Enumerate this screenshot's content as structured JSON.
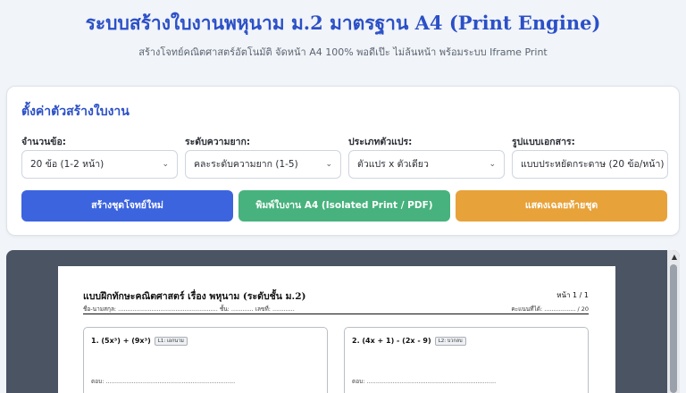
{
  "header": {
    "title": "ระบบสร้างใบงานพหุนาม ม.2 มาตรฐาน A4 (Print Engine)",
    "subtitle": "สร้างโจทย์คณิตศาสตร์อัตโนมัติ จัดหน้า A4 100% พอดีเป๊ะ ไม่ล้นหน้า พร้อมระบบ Iframe Print"
  },
  "settings": {
    "title": "ตั้งค่าตัวสร้างใบงาน",
    "fields": [
      {
        "label": "จำนวนข้อ:",
        "value": "20 ข้อ (1-2 หน้า)"
      },
      {
        "label": "ระดับความยาก:",
        "value": "คละระดับความยาก (1-5)"
      },
      {
        "label": "ประเภทตัวแปร:",
        "value": "ตัวแปร x ตัวเดียว"
      },
      {
        "label": "รูปแบบเอกสาร:",
        "value": "แบบประหยัดกระดาษ (20 ข้อ/หน้า)"
      }
    ],
    "buttons": {
      "generate": "สร้างชุดโจทย์ใหม่",
      "print": "พิมพ์ใบงาน A4 (Isolated Print / PDF)",
      "answers": "แสดงเฉลยท้ายชุด"
    }
  },
  "worksheet": {
    "title": "แบบฝึกทักษะคณิตศาสตร์ เรื่อง พหุนาม (ระดับชั้น ม.2)",
    "page": "หน้า 1 / 1",
    "meta": "ชื่อ-นามสกุล: ...................................................... ชั้น: ............ เลขที่: ............",
    "score": "คะแนนที่ได้: ................. / 20",
    "questions": [
      {
        "text": "1. (5x³) + (9x³)",
        "tag": "L1: เอกนาม",
        "answer": "ตอบ: ......................................................................"
      },
      {
        "text": "2. (4x + 1) - (2x - 9)",
        "tag": "L2: บวกลบ",
        "answer": "ตอบ: ......................................................................"
      }
    ]
  },
  "colors": {
    "accent": "#2b50c7",
    "generate_button": "#3c64de",
    "print_button": "#47b27d",
    "answers_button": "#e8a23a",
    "preview_background": "#4b5463"
  },
  "icons": {
    "select_chevron": "chevron-down-icon",
    "scroll_up": "scroll-up-arrow-icon"
  }
}
